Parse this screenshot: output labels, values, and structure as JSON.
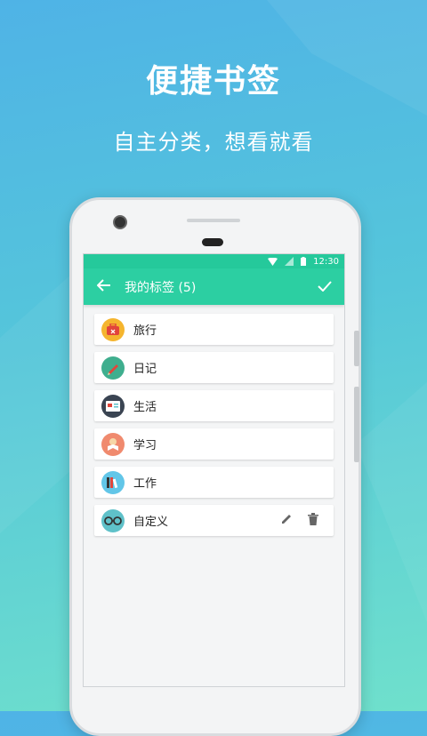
{
  "promo": {
    "title": "便捷书签",
    "subtitle": "自主分类，想看就看"
  },
  "status_bar": {
    "time": "12:30",
    "icons": [
      "wifi-icon",
      "signal-icon",
      "battery-icon"
    ]
  },
  "app_bar": {
    "back_icon": "arrow-left-icon",
    "title": "我的标签 (5)",
    "confirm_icon": "check-icon"
  },
  "tags": [
    {
      "label": "旅行",
      "icon": "suitcase-icon",
      "color": "#f5b52e"
    },
    {
      "label": "日记",
      "icon": "pen-icon",
      "color": "#3fae8e"
    },
    {
      "label": "生活",
      "icon": "card-icon",
      "color": "#3a4452"
    },
    {
      "label": "学习",
      "icon": "reader-icon",
      "color": "#f08a6e"
    },
    {
      "label": "工作",
      "icon": "folder-icon",
      "color": "#62c6e8"
    },
    {
      "label": "自定义",
      "icon": "glasses-icon",
      "color": "#5fc1c9",
      "actions": [
        "edit-icon",
        "trash-icon"
      ]
    }
  ],
  "colors": {
    "accent": "#2ccfa2",
    "status": "#25c99b"
  }
}
